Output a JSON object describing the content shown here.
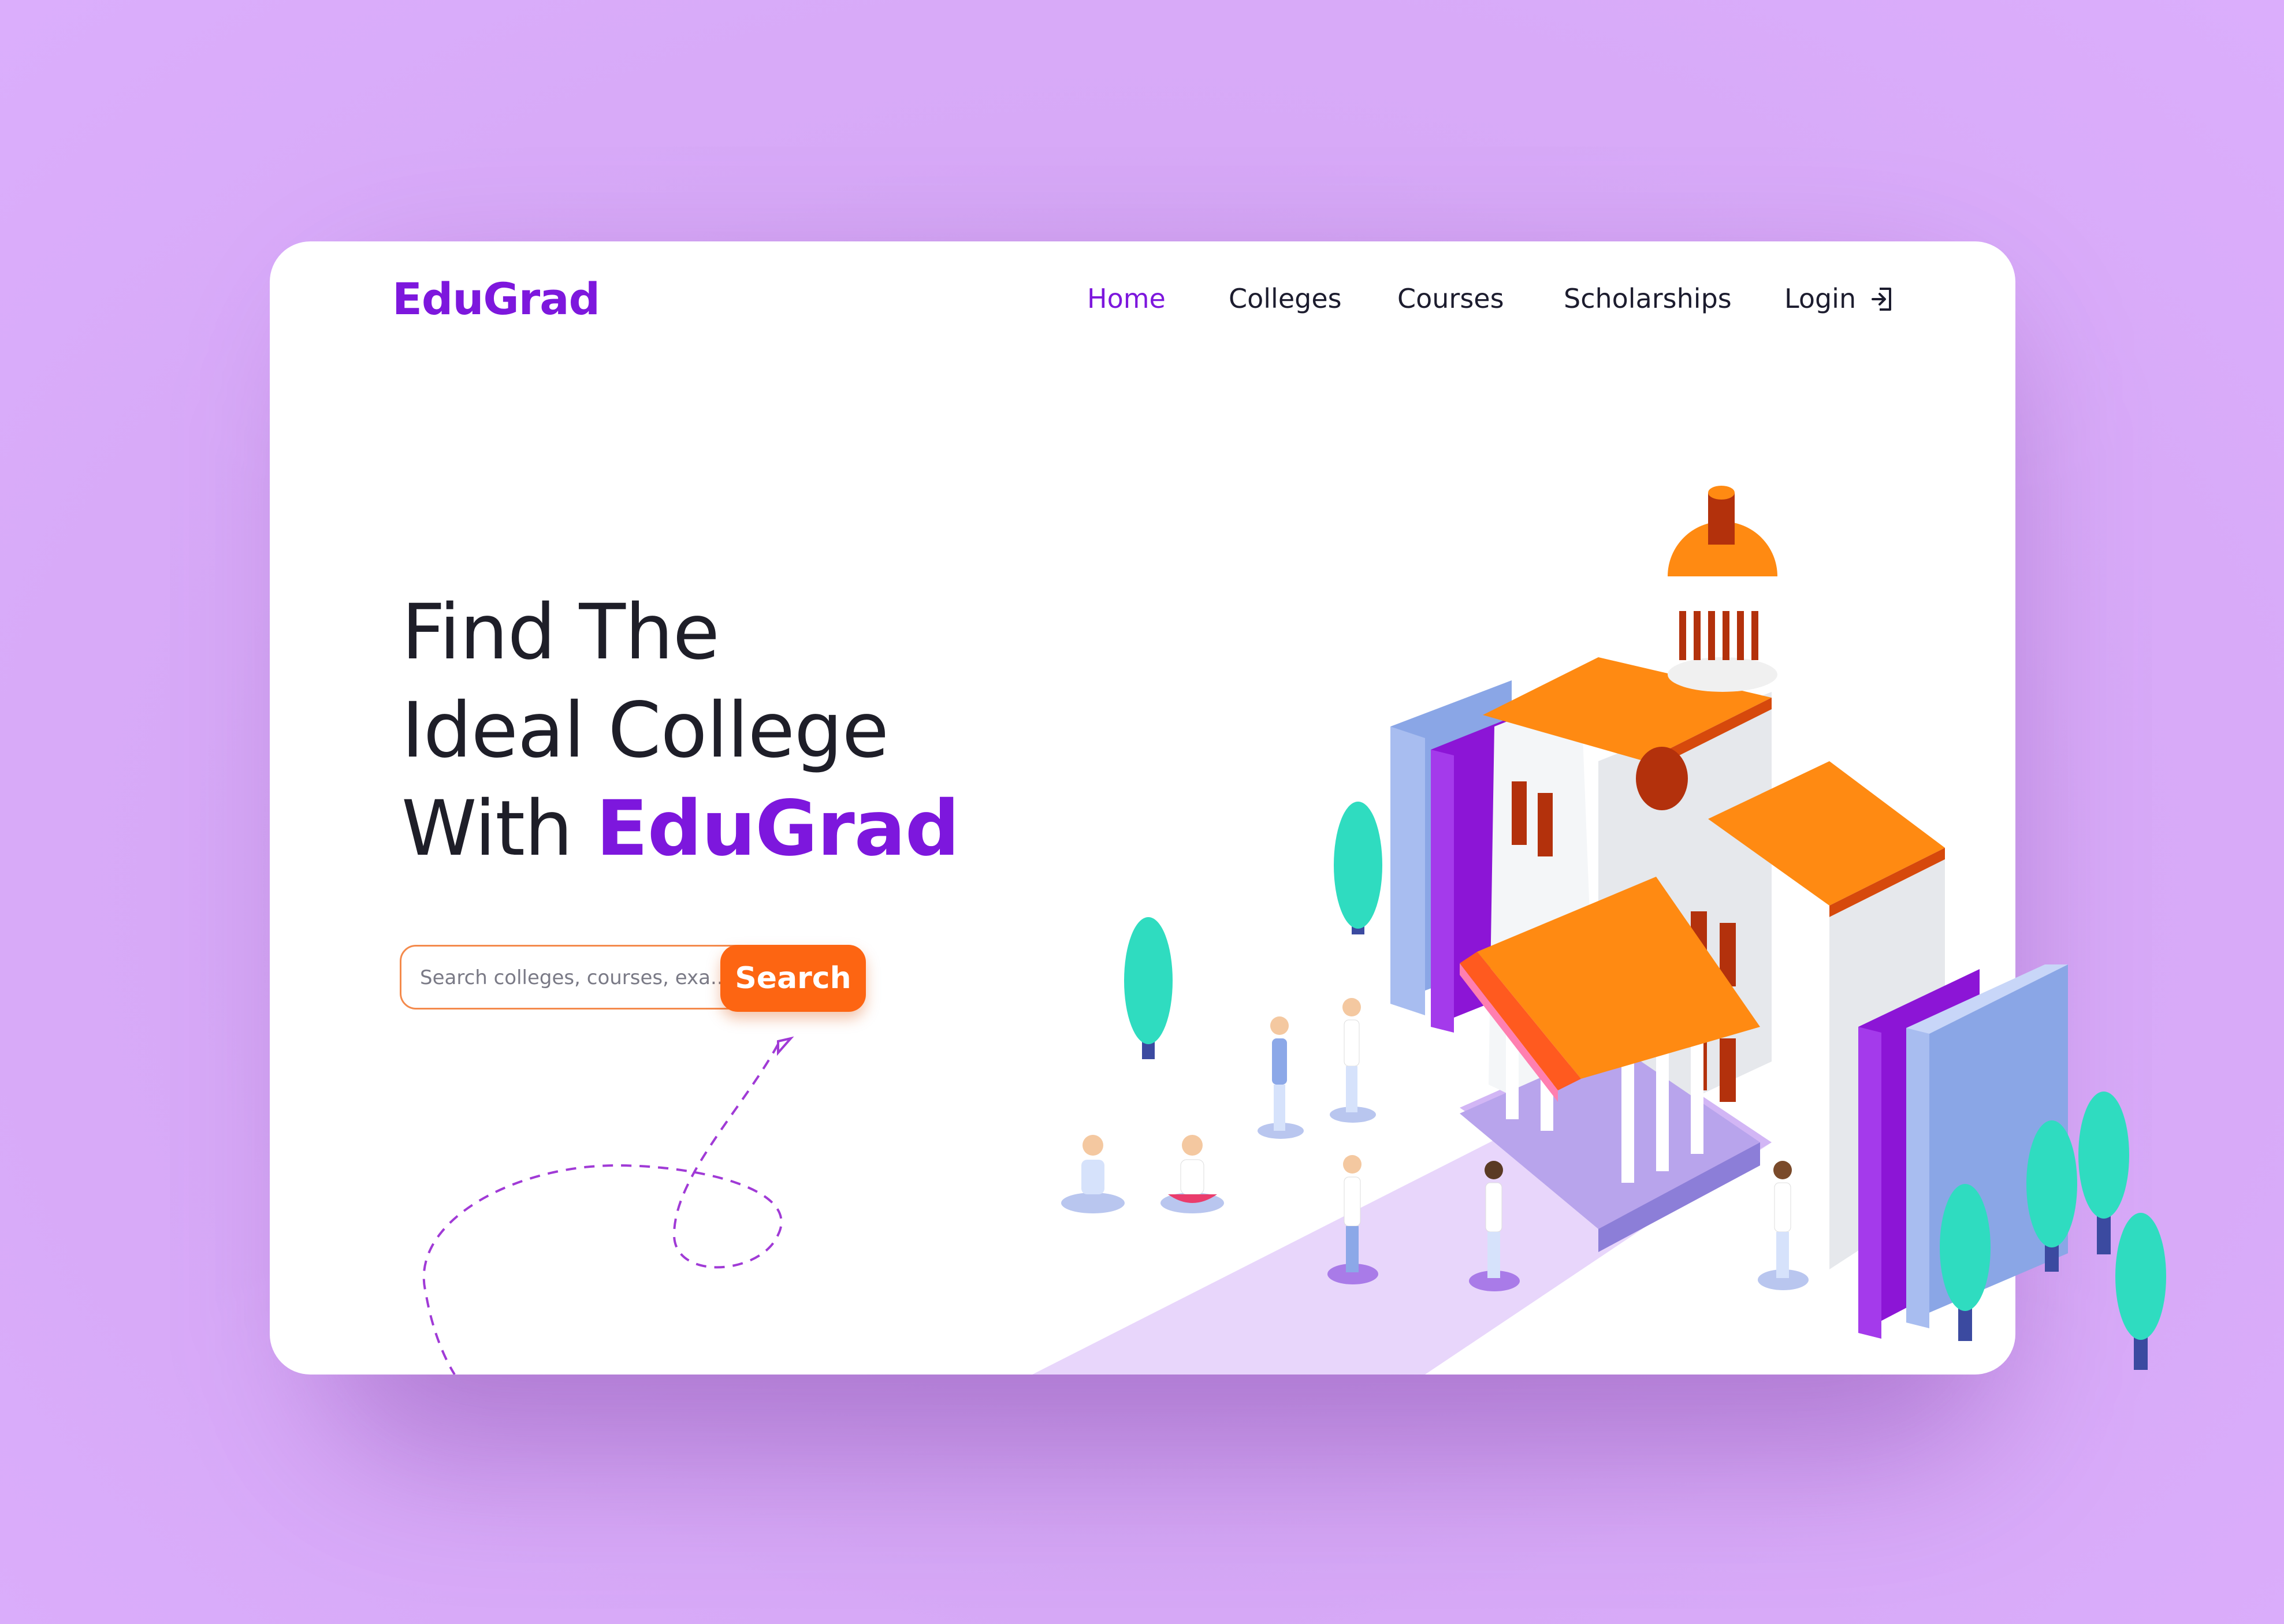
{
  "app": {
    "logo": "EduGrad"
  },
  "nav": {
    "items": [
      {
        "label": "Home",
        "active": true
      },
      {
        "label": "Colleges",
        "active": false
      },
      {
        "label": "Courses",
        "active": false
      },
      {
        "label": "Scholarships",
        "active": false
      },
      {
        "label": "Login",
        "active": false
      }
    ],
    "login_icon": "login-arrow-icon"
  },
  "hero": {
    "line1": "Find The",
    "line2": "Ideal College",
    "line3_prefix": "With",
    "line3_brand": "EduGrad"
  },
  "search": {
    "placeholder": "Search colleges, courses, exa...",
    "button_label": "Search"
  },
  "colors": {
    "page_background": "#d7a9f7",
    "brand_purple": "#7d17dd",
    "accent_orange": "#fd6512",
    "tree_teal": "#2fdcc0",
    "book_blue": "#7f9ce0"
  }
}
